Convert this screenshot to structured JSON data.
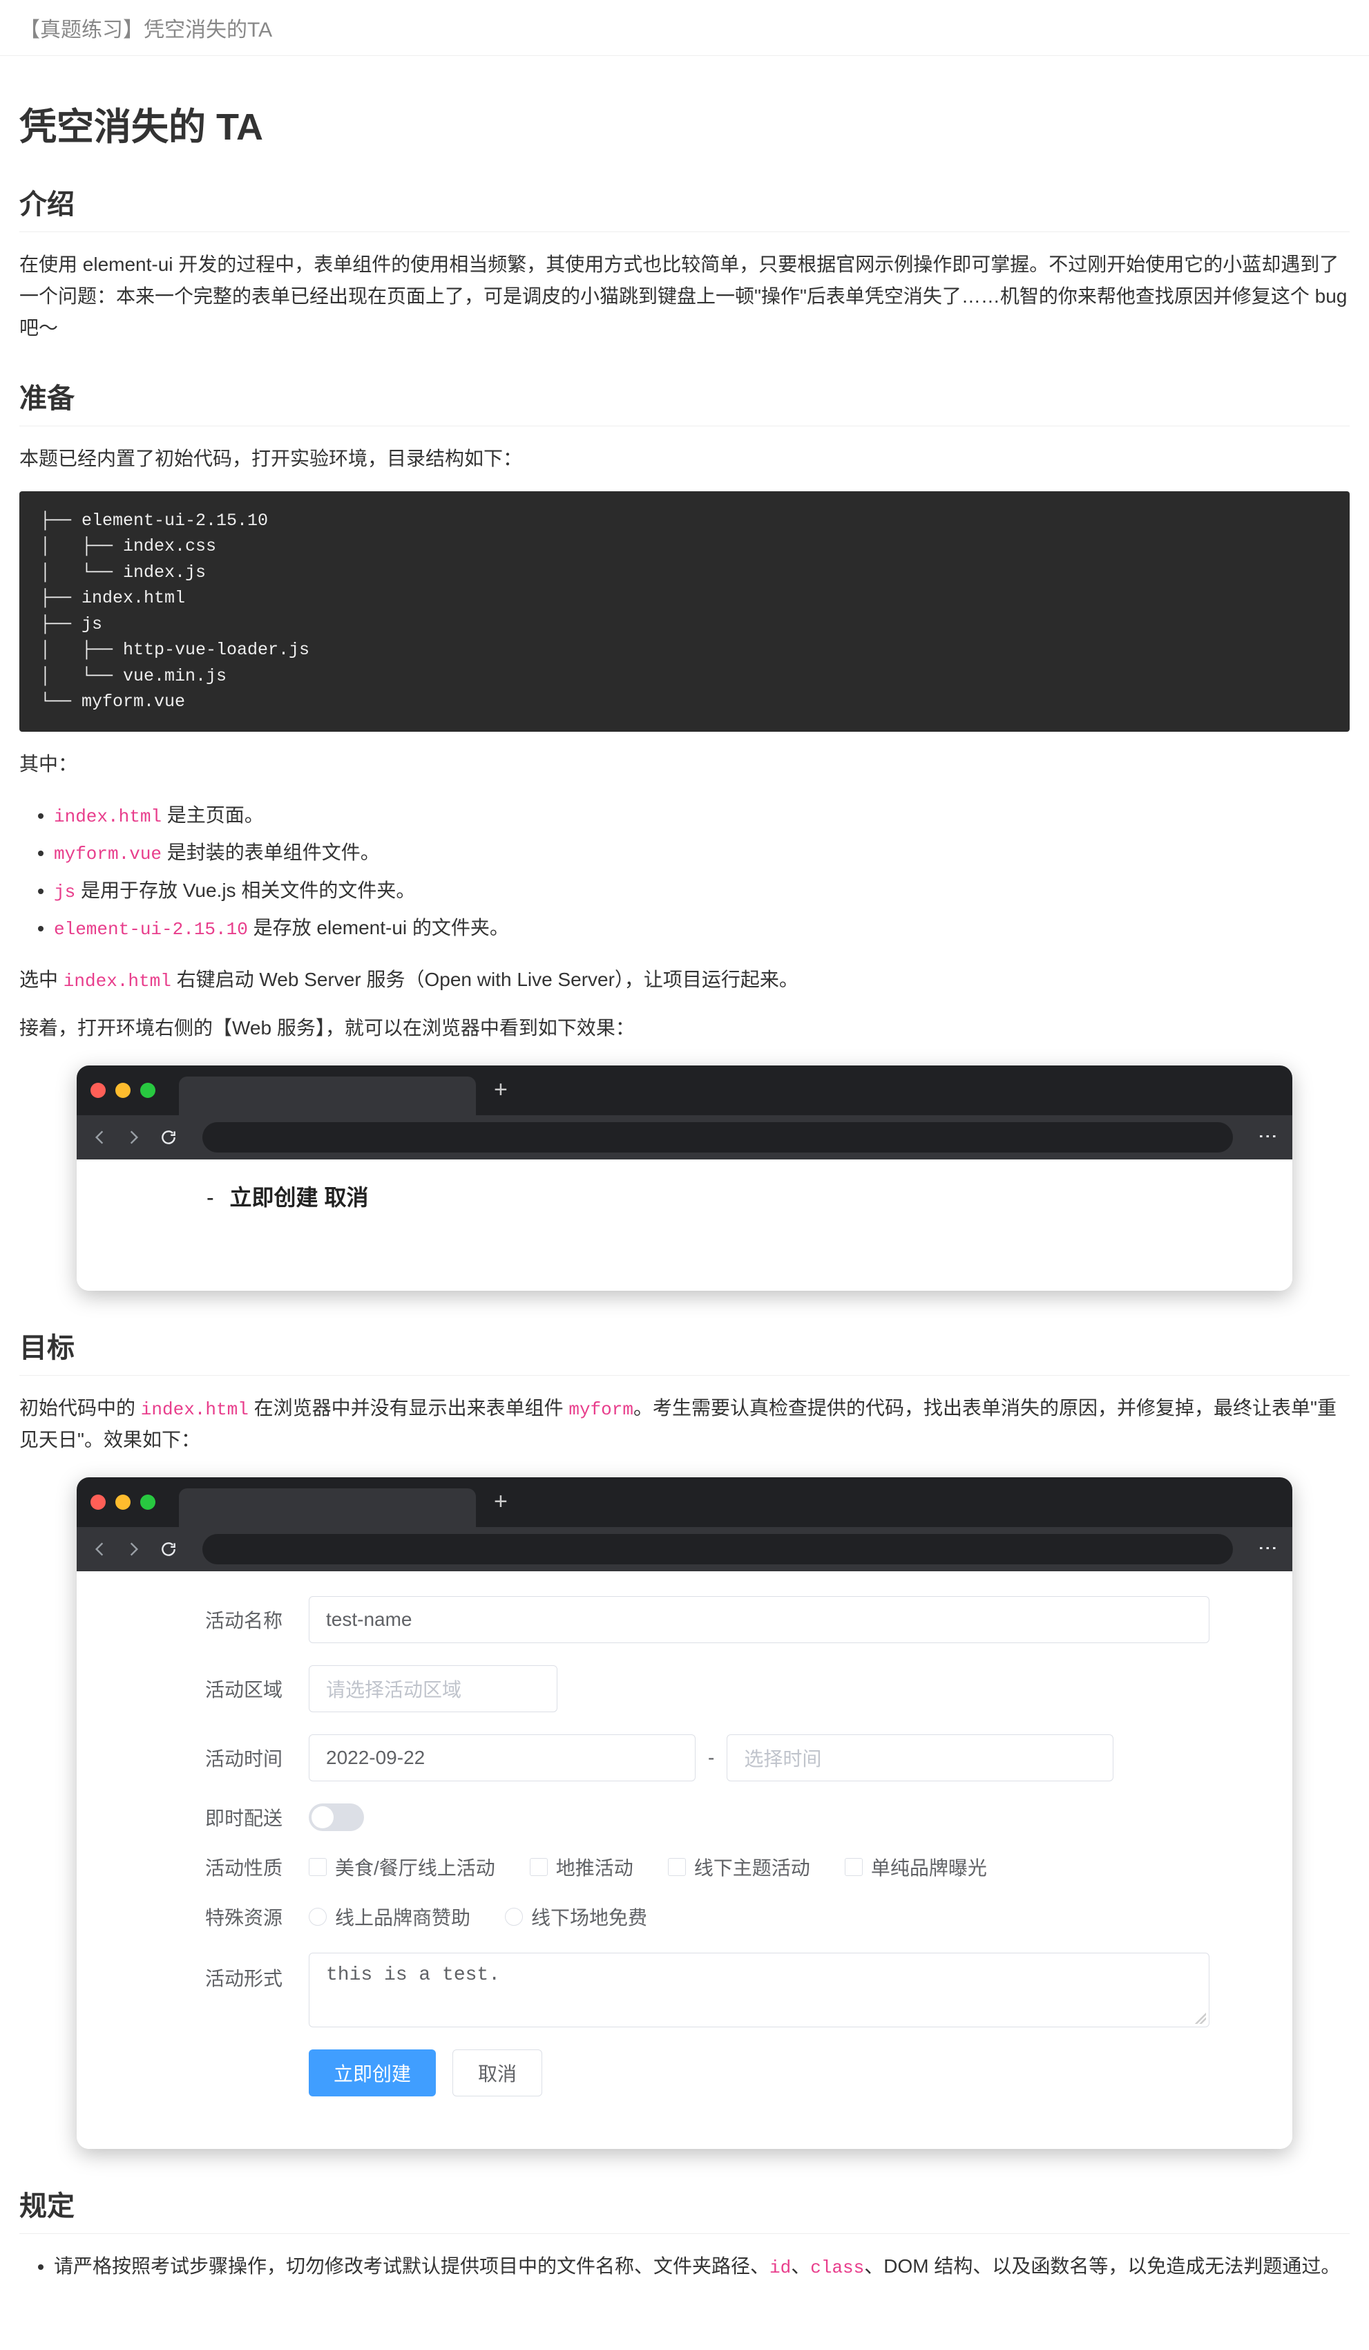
{
  "topbar": "【真题练习】凭空消失的TA",
  "title_h1": "凭空消失的 TA",
  "sections": {
    "intro_h2": "介绍",
    "intro_p": "在使用 element-ui 开发的过程中，表单组件的使用相当频繁，其使用方式也比较简单，只要根据官网示例操作即可掌握。不过刚开始使用它的小蓝却遇到了一个问题：本来一个完整的表单已经出现在页面上了，可是调皮的小猫跳到键盘上一顿\"操作\"后表单凭空消失了……机智的你来帮他查找原因并修复这个 bug 吧～",
    "prep_h2": "准备",
    "prep_p": "本题已经内置了初始代码，打开实验环境，目录结构如下：",
    "codeblock": "├── element-ui-2.15.10\n│   ├── index.css\n│   └── index.js\n├── index.html\n├── js\n│   ├── http-vue-loader.js\n│   └── vue.min.js\n└── myform.vue",
    "file_desc_lead": "其中：",
    "file_desc": [
      {
        "code": "index.html",
        "text": " 是主页面。"
      },
      {
        "code": "myform.vue",
        "text": " 是封装的表单组件文件。"
      },
      {
        "code": "js",
        "text": " 是用于存放 Vue.js 相关文件的文件夹。"
      },
      {
        "code": "element-ui-2.15.10",
        "text": " 是存放 element-ui 的文件夹。"
      }
    ],
    "run_p_before": "选中 ",
    "run_p_code": "index.html",
    "run_p_after": " 右键启动 Web Server 服务（Open with Live Server），让项目运行起来。",
    "preview_p": "接着，打开环境右侧的【Web 服务】，就可以在浏览器中看到如下效果：",
    "target_h2": "目标",
    "target_p_a": "初始代码中的 ",
    "target_p_code1": "index.html",
    "target_p_b": " 在浏览器中并没有显示出来表单组件 ",
    "target_p_code2": "myform",
    "target_p_c": "。考生需要认真检查提供的代码，找出表单消失的原因，并修复掉，最终让表单\"重见天日\"。效果如下：",
    "rules_h2": "规定",
    "rule_prefix": "请严格按照考试步骤操作，切勿修改考试默认提供项目中的文件名称、文件夹路径、",
    "rule_code1": "id",
    "rule_sep1": "、",
    "rule_code2": "class",
    "rule_suffix": "、DOM 结构、以及函数名等，以免造成无法判题通过。"
  },
  "browser1": {
    "broken_text_a": "立即创建",
    "broken_text_b": "取消"
  },
  "form": {
    "labels": {
      "name": "活动名称",
      "region": "活动区域",
      "time": "活动时间",
      "delivery": "即时配送",
      "type": "活动性质",
      "resource": "特殊资源",
      "desc": "活动形式"
    },
    "values": {
      "name": "test-name",
      "region_placeholder": "请选择活动区域",
      "date1": "2022-09-22",
      "date2_placeholder": "选择时间",
      "desc": "this is a test."
    },
    "checkboxes": [
      "美食/餐厅线上活动",
      "地推活动",
      "线下主题活动",
      "单纯品牌曝光"
    ],
    "radios": [
      "线上品牌商赞助",
      "线下场地免费"
    ],
    "buttons": {
      "submit": "立即创建",
      "cancel": "取消"
    },
    "date_separator": "-"
  }
}
